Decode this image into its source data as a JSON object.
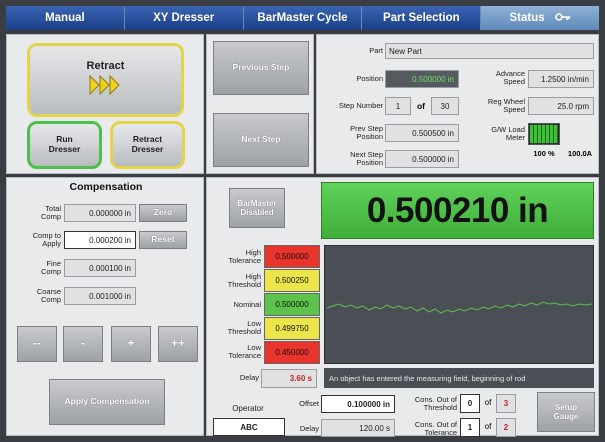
{
  "tabs": [
    {
      "label": "Manual"
    },
    {
      "label": "XY Dresser"
    },
    {
      "label": "BarMaster Cycle"
    },
    {
      "label": "Part Selection"
    },
    {
      "label": "Status"
    }
  ],
  "controls": {
    "retract_label": "Retract",
    "run_dresser_label": "Run\nDresser",
    "retract_dresser_label": "Retract\nDresser"
  },
  "steps": {
    "previous_label": "Previous Step",
    "next_label": "Next Step"
  },
  "part": {
    "part_label": "Part",
    "part_value": "New Part",
    "position_label": "Position",
    "position_value": "0.500000 in",
    "step_number_label": "Step Number",
    "step_current": "1",
    "step_of": "of",
    "step_total": "30",
    "prev_step_label": "Prev Step\nPosition",
    "prev_step_value": "0.500500 in",
    "next_step_label": "Next Step\nPosition",
    "next_step_value": "0.500000 in",
    "advance_speed_label": "Advance\nSpeed",
    "advance_speed_value": "1.2500 in/min",
    "reg_wheel_label": "Reg Wheel\nSpeed",
    "reg_wheel_value": "25.0 rpm",
    "gw_load_label": "G/W Load\nMeter",
    "gw_load_percent_text": "100 %",
    "gw_load_amps_text": "100.0A",
    "gw_load_fraction": 1.0
  },
  "compensation": {
    "title": "Compensation",
    "total_comp_label": "Total\nComp",
    "total_comp_value": "0.000000 in",
    "zero_label": "Zero",
    "comp_apply_label": "Comp to\nApply",
    "comp_apply_value": "0.000200 in",
    "reset_label": "Reset",
    "fine_comp_label": "Fine\nComp",
    "fine_comp_value": "0.000100 in",
    "coarse_comp_label": "Coarse\nComp",
    "coarse_comp_value": "0.001000 in",
    "step_buttons": [
      "--",
      "-",
      "+",
      "++"
    ],
    "apply_label": "Apply Compensation"
  },
  "gauge": {
    "barmaster_label": "BarMaster\nDisabled",
    "reading": "0.500210 in",
    "high_tol_label": "High\nTolerance",
    "high_tol_value": "0.500000",
    "high_thr_label": "High\nThreshold",
    "high_thr_value": "0.500250",
    "nominal_label": "Nominal",
    "nominal_value": "0.500000",
    "low_thr_label": "Low\nThreshold",
    "low_thr_value": "0.499750",
    "low_tol_label": "Low\nTolerance",
    "low_tol_value": "0.450000",
    "delay_label": "Delay",
    "delay_value": "3.60 s",
    "message": "An object has entered the measuring field, beginning of rod",
    "operator_label": "Operator",
    "operator_value": "ABC",
    "offset_label": "Offset",
    "offset_value": "0.100000 in",
    "delay2_label": "Delay",
    "delay2_value": "120.00 s",
    "cons_thr_label": "Cons. Out of\nThreshold",
    "cons_thr_value": "0",
    "cons_thr_of": "of",
    "cons_thr_max": "3",
    "cons_tol_label": "Cons. Out of\nTolerance",
    "cons_tol_value": "1",
    "cons_tol_of": "of",
    "cons_tol_max": "2",
    "setup_label": "Setup\nGauge"
  },
  "colors": {
    "tab_blue": "#1c3f87",
    "reading_green": "#4cc04c",
    "tol_red": "#e8342b",
    "thr_yellow": "#ece54a",
    "nominal_green": "#5cc24a",
    "graph_bg": "#4a4f55",
    "trace_green": "#5bc24a",
    "yellow_ring": "#e2d54a",
    "green_ring": "#4cc04c"
  },
  "icons": {
    "retract_arrows": "triple-chevron-right-icon",
    "status_tab": "key-icon"
  }
}
